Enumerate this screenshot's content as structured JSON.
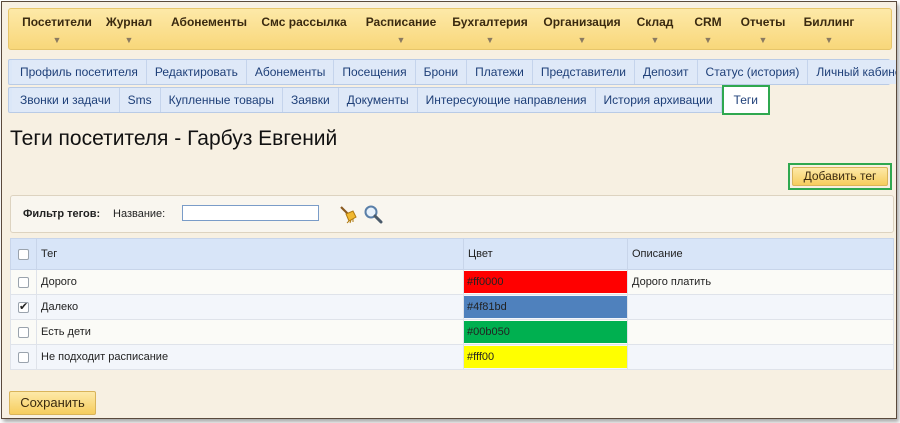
{
  "menu": [
    {
      "label": "Посетители",
      "arrow": "▼"
    },
    {
      "label": "Журнал",
      "arrow": "▼"
    },
    {
      "label": "Абонементы",
      "arrow": ""
    },
    {
      "label": "Смс рассылка",
      "arrow": ""
    },
    {
      "label": "Расписание",
      "arrow": "▼"
    },
    {
      "label": "Бухгалтерия",
      "arrow": "▼"
    },
    {
      "label": "Организация",
      "arrow": "▼"
    },
    {
      "label": "Склад",
      "arrow": "▼"
    },
    {
      "label": "CRM",
      "arrow": "▼"
    },
    {
      "label": "Отчеты",
      "arrow": "▼"
    },
    {
      "label": "Биллинг",
      "arrow": "▼"
    }
  ],
  "tabs_row1": [
    "Профиль посетителя",
    "Редактировать",
    "Абонементы",
    "Посещения",
    "Брони",
    "Платежи",
    "Представители",
    "Депозит",
    "Статус (история)",
    "Личный кабинет"
  ],
  "tabs_row2": [
    "Звонки и задачи",
    "Sms",
    "Купленные товары",
    "Заявки",
    "Документы",
    "Интересующие направления",
    "История архивации",
    "Теги"
  ],
  "page": {
    "title": "Теги посетителя - Гарбуз Евгений"
  },
  "toolbar": {
    "add_label": "Добавить тег"
  },
  "filter": {
    "title": "Фильтр тегов:",
    "name_label": "Название:",
    "name_value": ""
  },
  "table": {
    "headers": {
      "tag": "Тег",
      "color": "Цвет",
      "description": "Описание"
    },
    "rows": [
      {
        "tag": "Дорого",
        "color": "#ff0000",
        "description": "Дорого платить",
        "checked": false
      },
      {
        "tag": "Далеко",
        "color": "#4f81bd",
        "description": "",
        "checked": true
      },
      {
        "tag": "Есть дети",
        "color": "#00b050",
        "description": "",
        "checked": false
      },
      {
        "tag": "Не подходит расписание",
        "color": "#fff00",
        "description": "",
        "checked": false
      }
    ]
  },
  "swatch_colors": [
    "#ff0000",
    "#4f81bd",
    "#00b050",
    "#ffff00"
  ],
  "footer": {
    "save_label": "Сохранить"
  },
  "colors": {
    "accent": "#2fa84f",
    "menu_bg": "#f8d77a",
    "tab_bg": "#dbe7f8"
  }
}
